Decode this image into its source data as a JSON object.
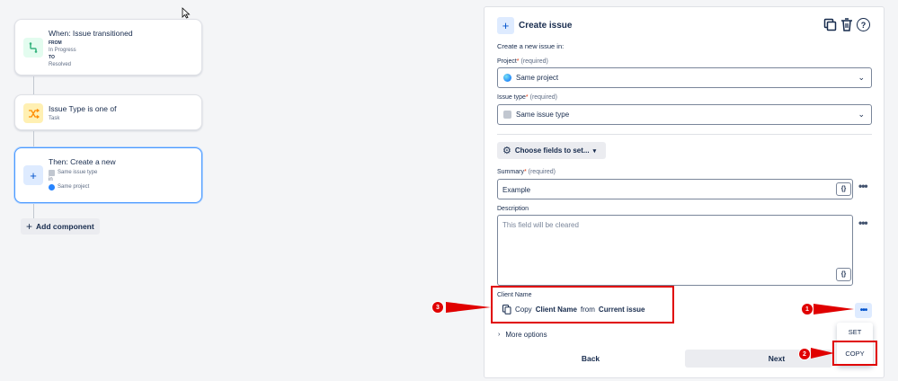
{
  "flow": {
    "trigger": {
      "title": "When: Issue transitioned",
      "from_label": "FROM",
      "from_value": "In Progress",
      "to_label": "TO",
      "to_value": "Resolved"
    },
    "condition": {
      "title": "Issue Type is one of",
      "value": "Task"
    },
    "action": {
      "title": "Then: Create a new",
      "line1": "Same issue type",
      "line2": "in",
      "line3": "Same project"
    },
    "add_component": "Add component"
  },
  "panel": {
    "header": "Create issue",
    "intro": "Create a new issue in:",
    "project": {
      "label": "Project",
      "req": "(required)",
      "value": "Same project"
    },
    "issue_type": {
      "label": "Issue type",
      "req": "(required)",
      "value": "Same issue type"
    },
    "choose_fields": "Choose fields to set...",
    "summary": {
      "label": "Summary",
      "req": "(required)",
      "value": "Example",
      "brace": "{}"
    },
    "description": {
      "label": "Description",
      "placeholder": "This field will be cleared",
      "brace": "{}"
    },
    "client_name": {
      "label": "Client Name",
      "copy_prefix": "Copy",
      "field": "Client Name",
      "mid": "from",
      "source": "Current issue"
    },
    "more_options": "More options",
    "menu": {
      "set": "SET",
      "copy": "COPY"
    },
    "back": "Back",
    "next": "Next"
  },
  "annotations": {
    "one": "1",
    "two": "2",
    "three": "3"
  },
  "colors": {
    "accent": "#0052cc",
    "annotation": "#e00000",
    "selected_border": "#4c9aff"
  }
}
